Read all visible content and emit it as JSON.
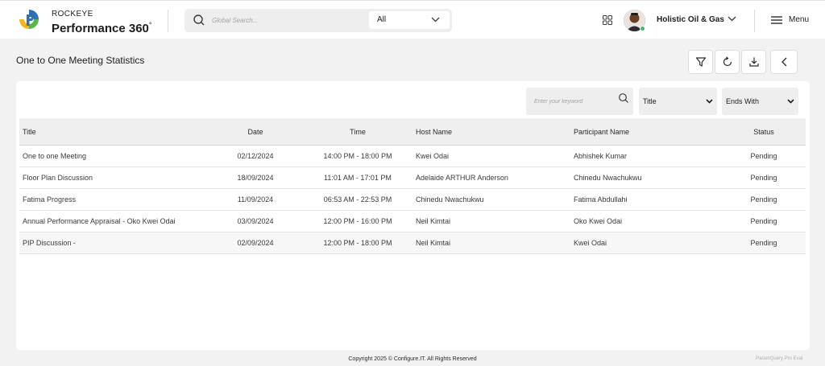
{
  "brand": {
    "top": "ROCKEYE",
    "main": "Performance 360",
    "suffix": "°",
    "colors": {
      "green": "#5bb54a",
      "blue": "#2f6fb5",
      "yellow": "#f4b41a"
    }
  },
  "header": {
    "search_placeholder": "Global Search...",
    "search_scope": "All",
    "org_name": "Holistic Oil & Gas",
    "menu_label": "Menu",
    "icons": [
      "search-icon",
      "chevron-down-icon",
      "apps-grid-icon",
      "avatar",
      "hamburger-icon"
    ]
  },
  "page": {
    "title": "One to One Meeting Statistics",
    "actions": [
      "filter-icon",
      "refresh-icon",
      "download-icon",
      "back-icon"
    ]
  },
  "filters": {
    "keyword_placeholder": "Enter your keyword",
    "field": "Title",
    "operator": "Ends With"
  },
  "table": {
    "columns": [
      "Title",
      "Date",
      "Time",
      "Host Name",
      "Participant Name",
      "Status"
    ],
    "rows": [
      [
        "One to one Meeting",
        "02/12/2024",
        "14:00 PM - 18:00 PM",
        "Kwei Odai",
        "Abhishek Kumar",
        "Pending"
      ],
      [
        "Floor Plan Discussion",
        "18/09/2024",
        "11:01 AM - 17:01 PM",
        "Adelaide ARTHUR Anderson",
        "Chinedu Nwachukwu",
        "Pending"
      ],
      [
        "Fatima Progress",
        "11/09/2024",
        "06:53 AM - 22:53 PM",
        "Chinedu Nwachukwu",
        "Fatima Abdullahi",
        "Pending"
      ],
      [
        "Annual Performance Appraisal - Oko Kwei Odai",
        "03/09/2024",
        "12:00 PM - 16:00 PM",
        "Neil Kimtai",
        "Oko Kwei Odai",
        "Pending"
      ],
      [
        "PIP Discussion -",
        "02/09/2024",
        "12:00 PM - 18:00 PM",
        "Neil Kimtai",
        "Kwei Odai",
        "Pending"
      ]
    ]
  },
  "footer": {
    "copyright": "Copyright 2025 © Configure.IT. All Rights Reserved",
    "tag": "ParamQuery Pro Eval"
  }
}
